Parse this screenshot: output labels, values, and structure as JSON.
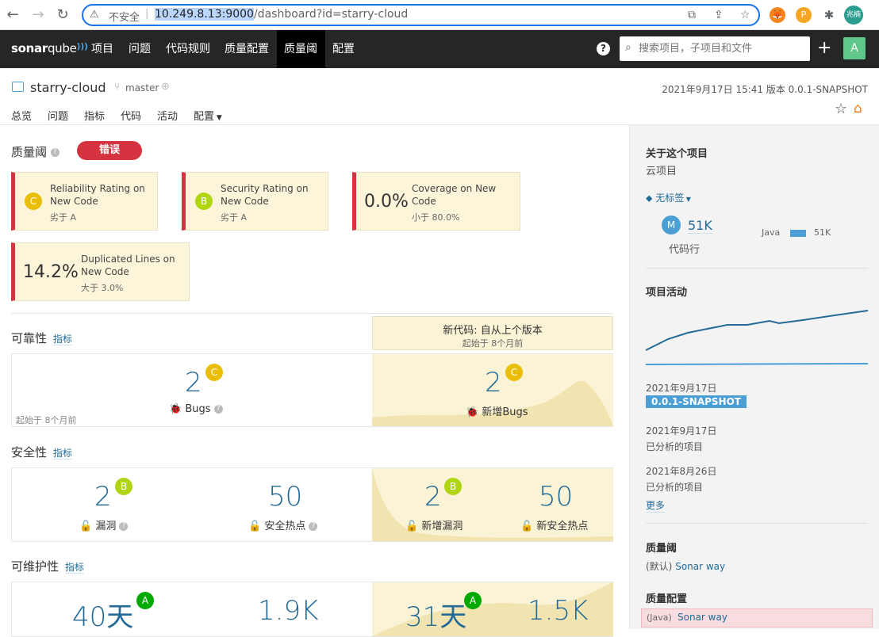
{
  "browser": {
    "insecure_label": "不安全",
    "url_host": "10.249.8.13:9000",
    "url_rest": "/dashboard?id=starry-cloud",
    "profile_label": "兆楠"
  },
  "nav": {
    "logo_a": "sonar",
    "logo_b": "qube",
    "items": [
      "项目",
      "问题",
      "代码规则",
      "质量配置",
      "质量阈",
      "配置"
    ],
    "search_placeholder": "搜索项目，子项目和文件",
    "avatar": "A"
  },
  "project": {
    "name": "starry-cloud",
    "branch": "master",
    "meta": "2021年9月17日 15:41   版本 0.0.1-SNAPSHOT",
    "tabs": [
      "总览",
      "问题",
      "指标",
      "代码",
      "活动",
      "配置"
    ]
  },
  "qg": {
    "title": "质量阈",
    "status": "错误",
    "conditions": [
      {
        "rating": "C",
        "label": "Reliability Rating on New Code",
        "sub": "劣于 A"
      },
      {
        "rating": "B",
        "label": "Security Rating on New Code",
        "sub": "劣于 A"
      },
      {
        "value": "0.0%",
        "label": "Coverage on New Code",
        "sub": "小于 80.0%"
      },
      {
        "value": "14.2%",
        "label": "Duplicated Lines on New Code",
        "sub": "大于 3.0%"
      }
    ]
  },
  "newcode": {
    "title": "新代码: 自从上个版本",
    "since": "起始于 8个月前"
  },
  "reliability": {
    "title": "可靠性",
    "link": "指标",
    "bugs": "2",
    "bugs_rating": "C",
    "bugs_label": "Bugs",
    "since": "起始于 8个月前",
    "new_bugs": "2",
    "new_bugs_rating": "C",
    "new_bugs_label": "新增Bugs"
  },
  "security": {
    "title": "安全性",
    "link": "指标",
    "vuln": "2",
    "vuln_rating": "B",
    "vuln_label": "漏洞",
    "hotspots": "50",
    "hotspots_label": "安全热点",
    "new_vuln": "2",
    "new_vuln_rating": "B",
    "new_vuln_label": "新增漏洞",
    "new_hotspots": "50",
    "new_hotspots_label": "新安全热点"
  },
  "maintainability": {
    "title": "可维护性",
    "link": "指标",
    "debt": "40天",
    "debt_rating": "A",
    "smells": "1.9K",
    "new_debt": "31天",
    "new_debt_rating": "A",
    "new_smells": "1.5K"
  },
  "sidebar": {
    "about_title": "关于这个项目",
    "about_desc": "云项目",
    "tags": "无标签",
    "loc_badge": "M",
    "loc_value": "51K",
    "loc_label": "代码行",
    "lang_name": "Java",
    "lang_value": "51K",
    "activity_title": "项目活动",
    "events": [
      {
        "date": "2021年9月17日",
        "version": "0.0.1-SNAPSHOT"
      },
      {
        "date": "2021年9月17日",
        "desc": "已分析的项目"
      },
      {
        "date": "2021年8月26日",
        "desc": "已分析的项目"
      }
    ],
    "more": "更多",
    "qg_title": "质量阈",
    "qg_default": "(默认)",
    "qg_name": "Sonar way",
    "qp_title": "质量配置",
    "qp_lang": "(Java)",
    "qp_name": "Sonar way"
  },
  "colors": {
    "error": "#d4333f",
    "rating_a": "#00aa00",
    "rating_b": "#b0d513",
    "rating_c": "#eabe06",
    "link": "#236a97",
    "new_code_bg": "#fbf3d5"
  }
}
